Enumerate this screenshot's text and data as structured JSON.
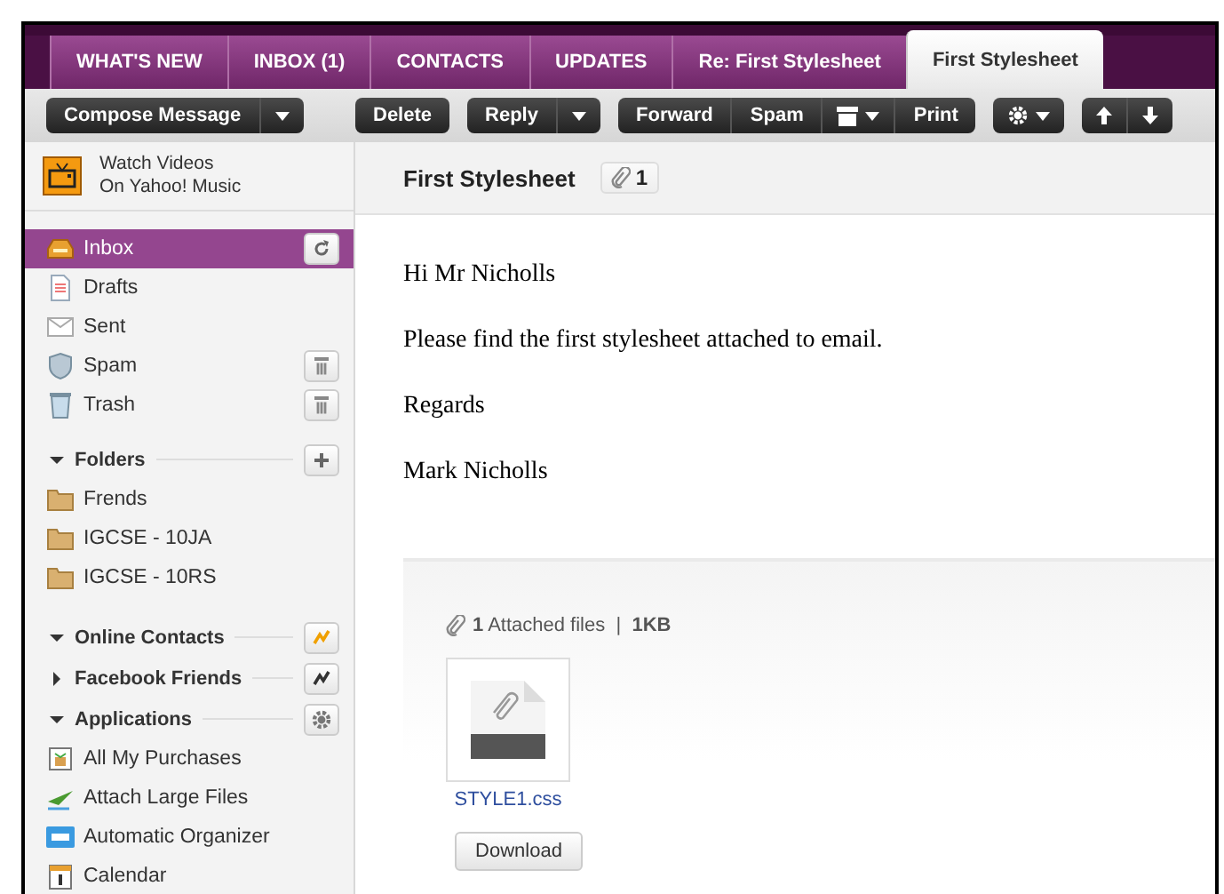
{
  "tabs": [
    {
      "label": "WHAT'S NEW",
      "selected": false
    },
    {
      "label": "INBOX (1)",
      "selected": false
    },
    {
      "label": "CONTACTS",
      "selected": false
    },
    {
      "label": "UPDATES",
      "selected": false
    },
    {
      "label": "Re: First Stylesheet",
      "selected": false
    },
    {
      "label": "First Stylesheet",
      "selected": true
    }
  ],
  "toolbar": [
    [
      {
        "kind": "text",
        "label": "Compose Message"
      },
      {
        "kind": "caret"
      }
    ],
    [
      {
        "kind": "text",
        "label": "Delete"
      }
    ],
    [
      {
        "kind": "text",
        "label": "Reply"
      },
      {
        "kind": "caret"
      }
    ],
    [
      {
        "kind": "text",
        "label": "Forward"
      },
      {
        "kind": "text",
        "label": "Spam"
      },
      {
        "kind": "move"
      },
      {
        "kind": "text",
        "label": "Print"
      }
    ],
    [
      {
        "kind": "settings"
      }
    ],
    [
      {
        "kind": "up"
      },
      {
        "kind": "down"
      }
    ]
  ],
  "sidebar": {
    "promo": [
      "Watch Videos",
      "On Yahoo! Music"
    ],
    "mailboxes": [
      {
        "kind": "inbox",
        "label": "Inbox",
        "selected": true,
        "button": {
          "kind": "refresh"
        }
      },
      {
        "kind": "drafts",
        "label": "Drafts",
        "selected": false
      },
      {
        "kind": "sent",
        "label": "Sent",
        "selected": false
      },
      {
        "kind": "spam",
        "label": "Spam",
        "selected": false,
        "button": {
          "kind": "empty"
        }
      },
      {
        "kind": "trash",
        "label": "Trash",
        "selected": false,
        "button": {
          "kind": "empty"
        }
      }
    ],
    "sections": [
      {
        "title": "Folders",
        "expanded": true,
        "button": {
          "kind": "add"
        },
        "items": [
          {
            "kind": "folder",
            "label": "Frends",
            "selected": false
          },
          {
            "kind": "folder",
            "label": "IGCSE - 10JA",
            "selected": false
          },
          {
            "kind": "folder",
            "label": "IGCSE - 10RS",
            "selected": false
          }
        ]
      },
      {
        "title": "Online Contacts",
        "expanded": true,
        "button": {
          "kind": "online"
        }
      },
      {
        "title": "Facebook Friends",
        "expanded": false,
        "button": {
          "kind": "offline"
        }
      },
      {
        "title": "Applications",
        "expanded": true,
        "button": {
          "kind": "settings"
        },
        "items": [
          {
            "kind": "purchases",
            "label": "All My Purchases",
            "selected": false
          },
          {
            "kind": "plane",
            "label": "Attach Large Files",
            "selected": false
          },
          {
            "kind": "organizer",
            "label": "Automatic Organizer",
            "selected": false
          },
          {
            "kind": "calendar",
            "label": "Calendar",
            "selected": false
          }
        ]
      }
    ]
  },
  "message": {
    "subject": "First Stylesheet",
    "attachment_count": "1",
    "body": [
      "Hi Mr Nicholls",
      "Please find the first stylesheet attached to email.",
      "Regards",
      "Mark Nicholls"
    ],
    "attachments": {
      "summary": "**1** Attached files  |  **1KB**",
      "files": [
        {
          "name": "STYLE1.css"
        }
      ],
      "button": "Download"
    }
  }
}
